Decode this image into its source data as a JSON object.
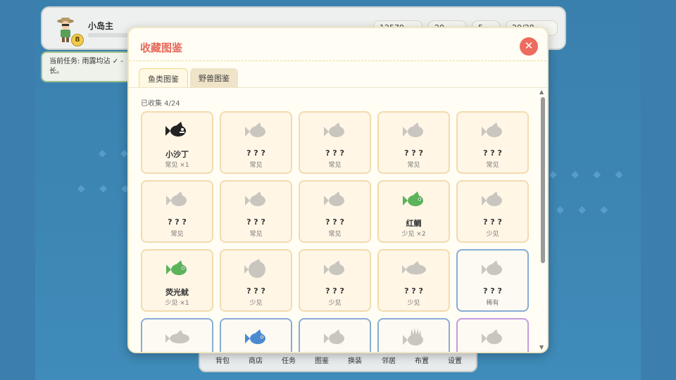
{
  "hud": {
    "player_name": "小岛主",
    "level": "8",
    "stats": [
      "12579",
      "20",
      "5",
      "20/28"
    ]
  },
  "task": {
    "text": "当前任务: 雨露均沾 ✓ - 长。"
  },
  "toolbar": {
    "items": [
      "背包",
      "商店",
      "任务",
      "图鉴",
      "换装",
      "邻居",
      "布置",
      "设置"
    ]
  },
  "modal": {
    "title": "收藏图鉴",
    "close": "✕",
    "tabs": [
      "鱼类图鉴",
      "野兽图鉴"
    ],
    "collected": "已收集 4/24",
    "cards": [
      {
        "name": "小沙丁",
        "sub": "常见 ×1",
        "fish": "dark",
        "tier": "common"
      },
      {
        "name": "? ? ?",
        "sub": "常见",
        "fish": "gray",
        "tier": "common"
      },
      {
        "name": "? ? ?",
        "sub": "常见",
        "fish": "gray",
        "tier": "common"
      },
      {
        "name": "? ? ?",
        "sub": "常见",
        "fish": "gray",
        "tier": "common"
      },
      {
        "name": "? ? ?",
        "sub": "常见",
        "fish": "gray",
        "tier": "common"
      },
      {
        "name": "? ? ?",
        "sub": "常见",
        "fish": "gray",
        "tier": "common"
      },
      {
        "name": "? ? ?",
        "sub": "常见",
        "fish": "gray",
        "tier": "common"
      },
      {
        "name": "? ? ?",
        "sub": "常见",
        "fish": "gray",
        "tier": "common"
      },
      {
        "name": "红鲷",
        "sub": "少见 ×2",
        "fish": "green",
        "tier": "common"
      },
      {
        "name": "? ? ?",
        "sub": "少见",
        "fish": "gray",
        "tier": "common"
      },
      {
        "name": "荧光鱿",
        "sub": "少见 ×1",
        "fish": "green",
        "tier": "common"
      },
      {
        "name": "? ? ?",
        "sub": "少见",
        "fish": "gray-round",
        "tier": "common"
      },
      {
        "name": "? ? ?",
        "sub": "少见",
        "fish": "gray",
        "tier": "common"
      },
      {
        "name": "? ? ?",
        "sub": "少见",
        "fish": "gray-long",
        "tier": "common"
      },
      {
        "name": "? ? ?",
        "sub": "稀有",
        "fish": "gray",
        "tier": "rare"
      },
      {
        "name": "",
        "sub": "",
        "fish": "gray-long",
        "tier": "rare"
      },
      {
        "name": "",
        "sub": "",
        "fish": "blue",
        "tier": "rare"
      },
      {
        "name": "",
        "sub": "",
        "fish": "gray",
        "tier": "rare"
      },
      {
        "name": "",
        "sub": "",
        "fish": "gray-spiky",
        "tier": "rare"
      },
      {
        "name": "",
        "sub": "",
        "fish": "gray",
        "tier": "epic"
      }
    ]
  },
  "colors": {
    "accent": "#e66a5c",
    "common_border": "#f2dcae",
    "rare_border": "#88acd6",
    "epic_border": "#c69be0"
  }
}
